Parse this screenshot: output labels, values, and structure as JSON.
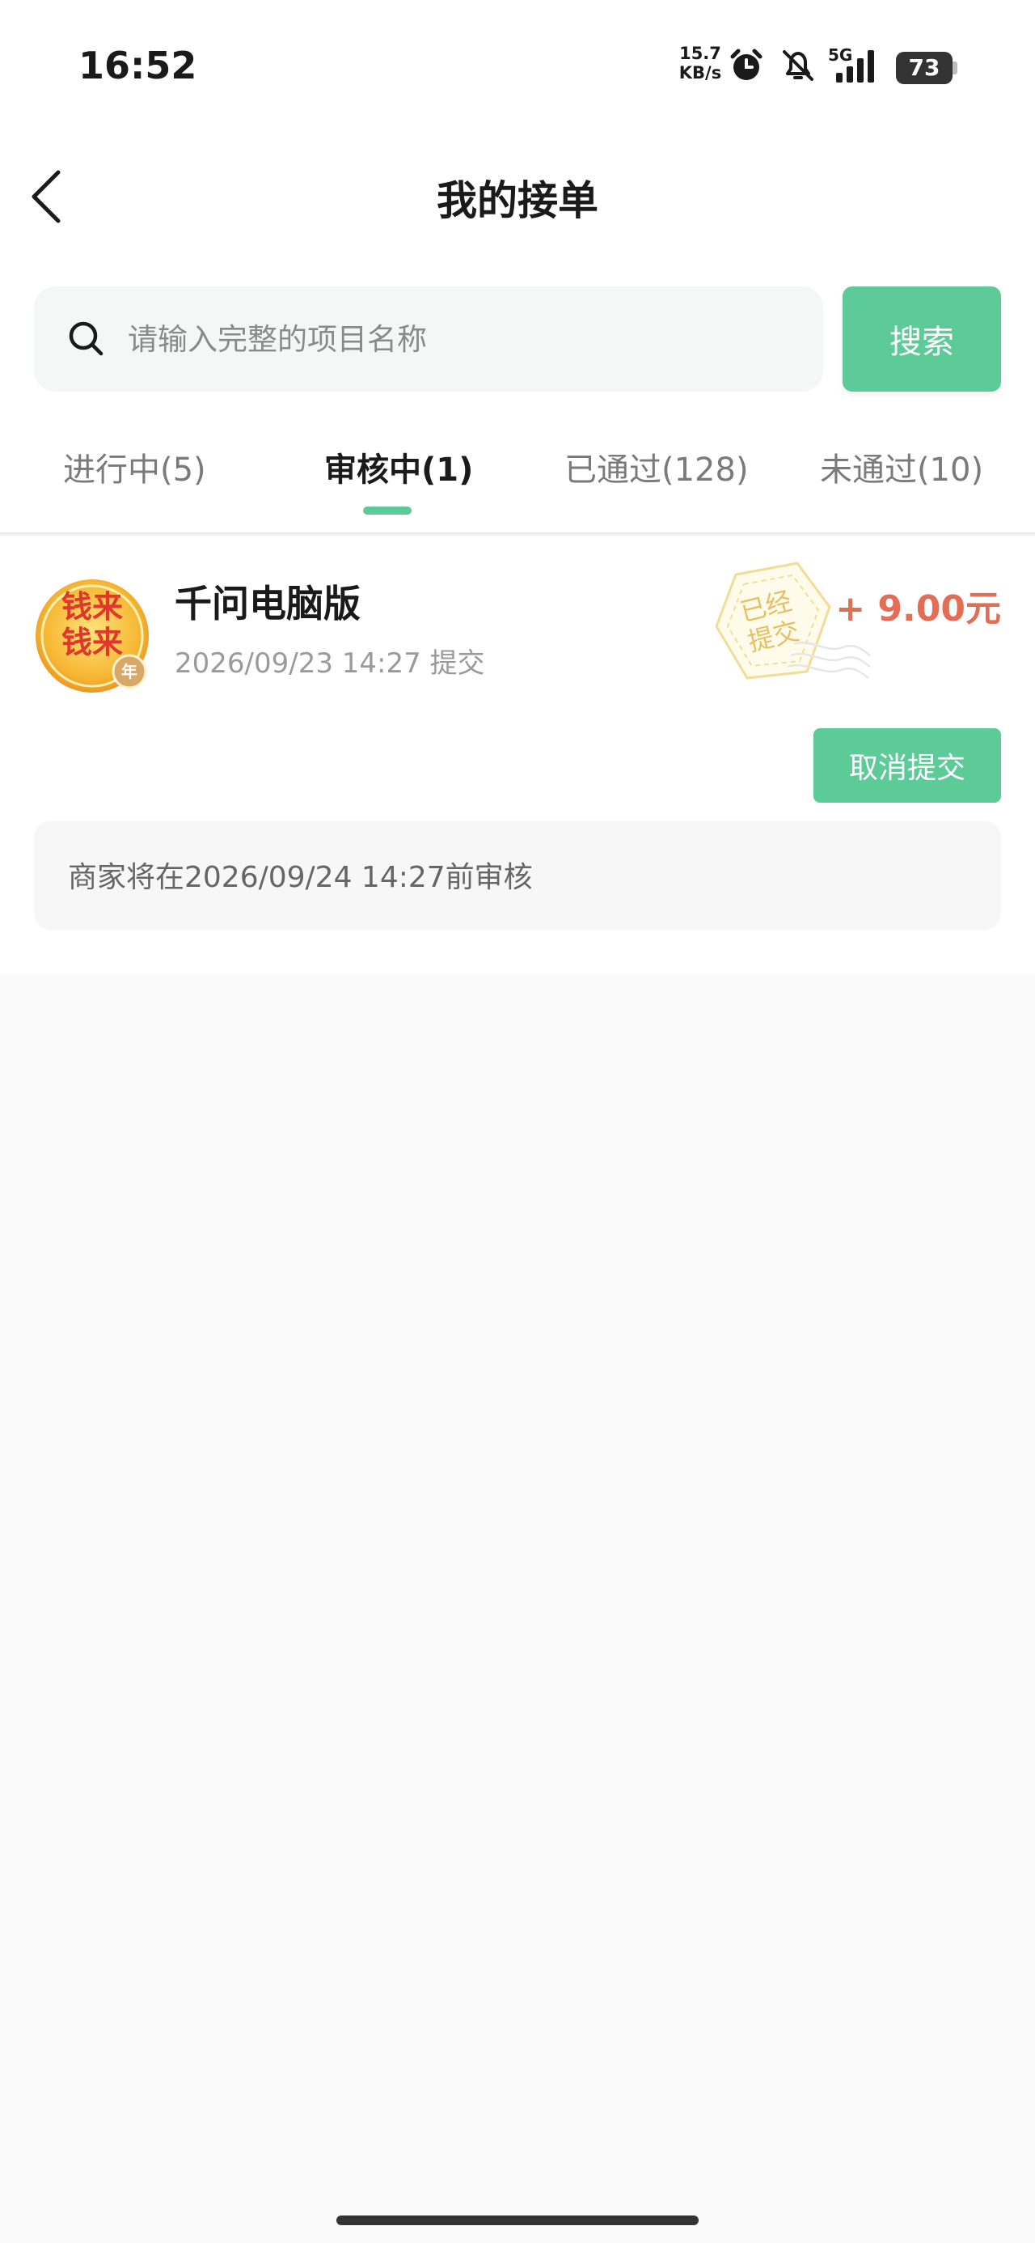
{
  "status_bar": {
    "time": "16:52",
    "net_speed_value": "15.7",
    "net_speed_unit": "KB/s",
    "network": "5G",
    "battery": "73",
    "icons": [
      "alarm-icon",
      "bell-muted-icon",
      "signal-icon",
      "battery-icon"
    ]
  },
  "header": {
    "title": "我的接单",
    "back_icon": "chevron-left-icon"
  },
  "search": {
    "placeholder": "请输入完整的项目名称",
    "value": "",
    "button_label": "搜索"
  },
  "tabs": [
    {
      "label": "进行中(5)",
      "active": false
    },
    {
      "label": "审核中(1)",
      "active": true
    },
    {
      "label": "已通过(128)",
      "active": false
    },
    {
      "label": "未通过(10)",
      "active": false
    }
  ],
  "order": {
    "thumbnail_text_line1": "钱来",
    "thumbnail_text_line2": "钱来",
    "thumbnail_badge": "年",
    "title": "千问电脑版",
    "submit_time": "2026/09/23 14:27 提交",
    "stamp_line1": "已经",
    "stamp_line2": "提交",
    "reward": "+ 9.00元",
    "cancel_label": "取消提交",
    "notice": "商家将在2026/09/24 14:27前审核"
  },
  "colors": {
    "accent": "#5dcb97",
    "reward": "#e46d55",
    "stamp": "#e7c063"
  }
}
